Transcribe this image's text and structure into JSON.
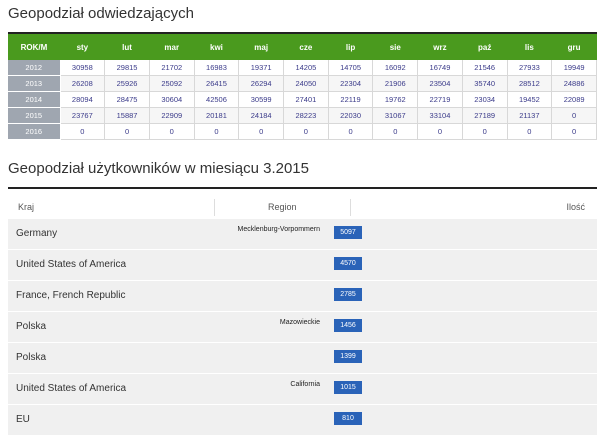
{
  "visits": {
    "title": "Geopodział odwiedzających",
    "header": [
      "ROK/M",
      "sty",
      "lut",
      "mar",
      "kwi",
      "maj",
      "cze",
      "lip",
      "sie",
      "wrz",
      "paź",
      "lis",
      "gru"
    ],
    "rows": [
      {
        "year": "2012",
        "values": [
          "30958",
          "29815",
          "21702",
          "16983",
          "19371",
          "14205",
          "14705",
          "16092",
          "16749",
          "21546",
          "27933",
          "19949"
        ]
      },
      {
        "year": "2013",
        "values": [
          "26208",
          "25926",
          "25092",
          "26415",
          "26294",
          "24050",
          "22304",
          "21906",
          "23504",
          "35740",
          "28512",
          "24886"
        ]
      },
      {
        "year": "2014",
        "values": [
          "28094",
          "28475",
          "30604",
          "42506",
          "30599",
          "27401",
          "22119",
          "19762",
          "22719",
          "23034",
          "19452",
          "22089"
        ]
      },
      {
        "year": "2015",
        "values": [
          "23767",
          "15887",
          "22909",
          "20181",
          "24184",
          "28223",
          "22030",
          "31067",
          "33104",
          "27189",
          "21137",
          "0"
        ]
      },
      {
        "year": "2016",
        "values": [
          "0",
          "0",
          "0",
          "0",
          "0",
          "0",
          "0",
          "0",
          "0",
          "0",
          "0",
          "0"
        ]
      }
    ],
    "colors": {
      "header": "#4a9a1e",
      "year_cell": "#9fa6b0"
    }
  },
  "users": {
    "title": "Geopodział użytkowników w miesiącu 3.2015",
    "columns": {
      "country": "Kraj",
      "region": "Region",
      "count": "Ilość"
    },
    "rows": [
      {
        "country": "Germany",
        "region": "Mecklenburg-Vorpommern",
        "count": "5097"
      },
      {
        "country": "United States of America",
        "region": "",
        "count": "4570"
      },
      {
        "country": "France, French Republic",
        "region": "",
        "count": "2785"
      },
      {
        "country": "Polska",
        "region": "Mazowieckie",
        "count": "1456"
      },
      {
        "country": "Polska",
        "region": "",
        "count": "1399"
      },
      {
        "country": "United States of America",
        "region": "California",
        "count": "1015"
      },
      {
        "country": "EU",
        "region": "",
        "count": "810"
      }
    ],
    "colors": {
      "badge": "#2a63b8"
    }
  }
}
